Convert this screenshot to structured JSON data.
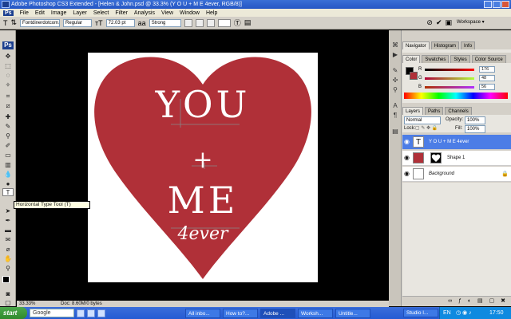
{
  "window": {
    "title": "Adobe Photoshop CS3 Extended - [Helen & John.psd @ 33.3% (Y O U + M E 4ever, RGB/8)]"
  },
  "menu": {
    "items": [
      "Ps",
      "File",
      "Edit",
      "Image",
      "Layer",
      "Select",
      "Filter",
      "Analysis",
      "View",
      "Window",
      "Help"
    ]
  },
  "options": {
    "font_family": "Fontdinerdotcom...",
    "font_style": "Regular",
    "font_size": "72.03 pt",
    "antialias": "Strong",
    "workspace": "Workspace ▾"
  },
  "tooltip": "Horizontal Type Tool (T)",
  "canvas_text": {
    "line1": "YOU",
    "line2": "+",
    "line3": "ME",
    "line4": "4ever"
  },
  "status": {
    "zoom": "33.33%",
    "doc": "Doc: 8.60M/0 bytes"
  },
  "panels": {
    "top_tabs": [
      "Navigator",
      "Histogram",
      "Info"
    ],
    "color_tabs": [
      "Color",
      "Swatches",
      "Styles",
      "Color Source"
    ],
    "rgb": [
      {
        "label": "R",
        "value": "176"
      },
      {
        "label": "G",
        "value": "48"
      },
      {
        "label": "B",
        "value": "56"
      }
    ],
    "layer_tabs": [
      "Layers",
      "Paths",
      "Channels"
    ],
    "blend_mode": "Normal",
    "opacity_label": "Opacity:",
    "opacity_value": "100%",
    "lock_label": "Lock:",
    "fill_label": "Fill:",
    "fill_value": "100%",
    "layers": [
      {
        "name": "Y O U + M E 4ever",
        "thumb": "T",
        "selected": true
      },
      {
        "name": "Shape 1",
        "thumb": "",
        "selected": false
      },
      {
        "name": "Background",
        "thumb": "",
        "selected": false
      }
    ]
  },
  "taskbar": {
    "start": "start",
    "google": "Google",
    "tasks": [
      "All inbo...",
      "How to?...",
      "Adobe ...",
      "Worksh...",
      "Untitle..."
    ],
    "right_tasks": [
      "Studio I..."
    ],
    "lang": "EN",
    "clock": "17:50"
  },
  "colors": {
    "heart": "#b03038",
    "selected_layer": "#4c7de6",
    "accent": "#2556c4"
  }
}
